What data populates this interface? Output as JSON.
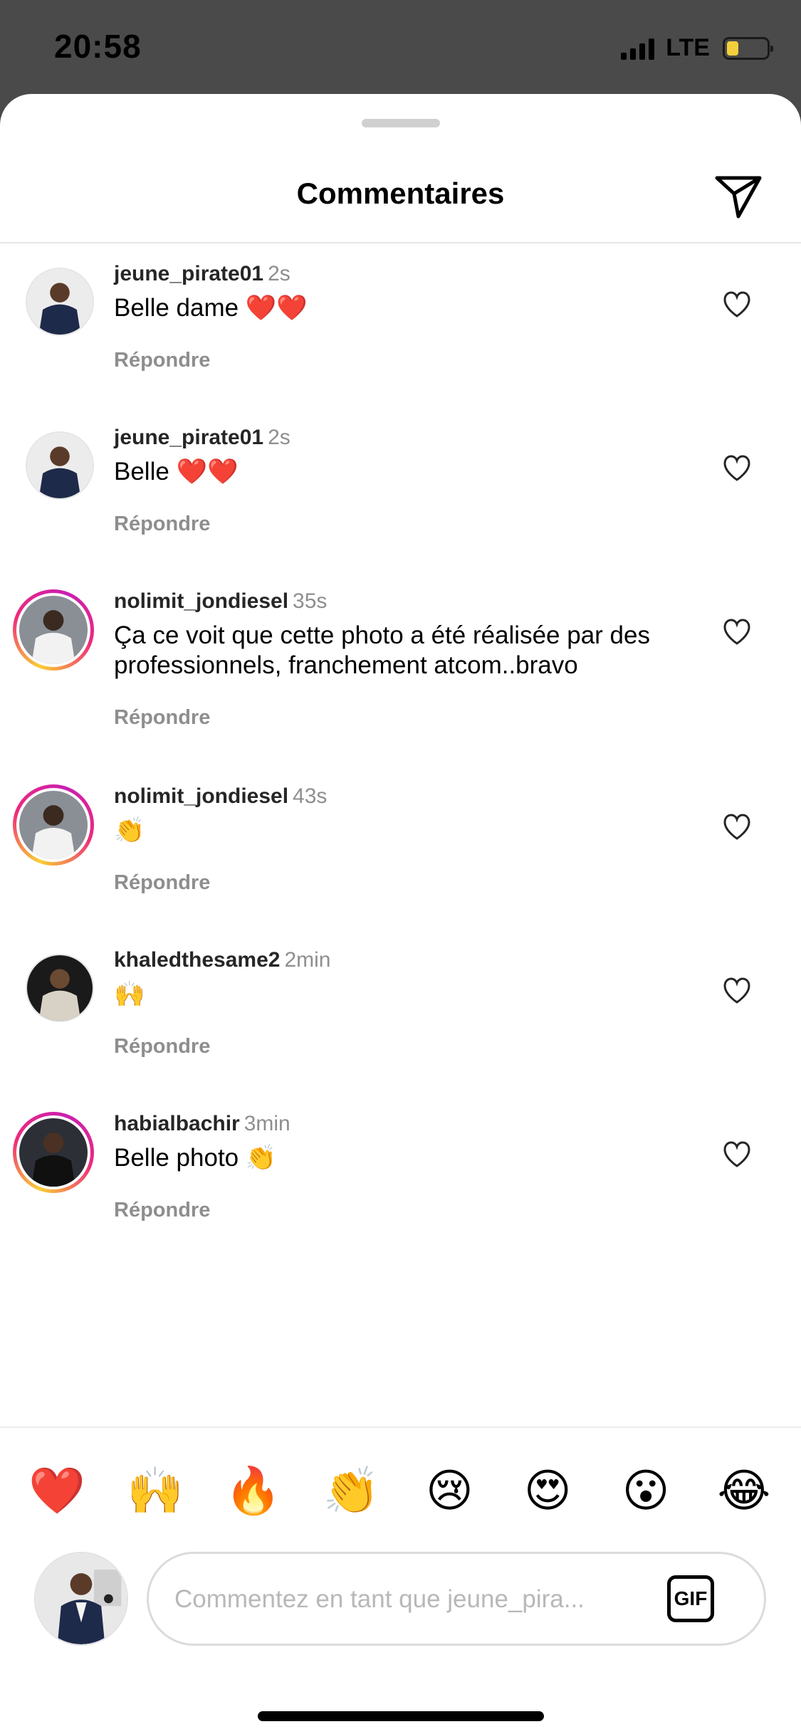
{
  "status_bar": {
    "time": "20:58",
    "network": "LTE",
    "battery_level": 0.3,
    "battery_color": "#f4cf3c"
  },
  "header": {
    "title": "Commentaires",
    "send_icon": "paper-plane-icon"
  },
  "comments": [
    {
      "username": "jeune_pirate01",
      "time": "2s",
      "text": "Belle dame ❤️❤️",
      "reply": "Répondre",
      "story_ring": false
    },
    {
      "username": "jeune_pirate01",
      "time": "2s",
      "text": "Belle ❤️❤️",
      "reply": "Répondre",
      "story_ring": false
    },
    {
      "username": "nolimit_jondiesel",
      "time": "35s",
      "text": "Ça ce voit que cette photo a été réalisée par des professionnels, franchement atcom..bravo",
      "reply": "Répondre",
      "story_ring": true
    },
    {
      "username": "nolimit_jondiesel",
      "time": "43s",
      "text": "👏",
      "reply": "Répondre",
      "story_ring": true
    },
    {
      "username": "khaledthesame2",
      "time": "2min",
      "text": "🙌",
      "reply": "Répondre",
      "story_ring": false
    },
    {
      "username": "habialbachir",
      "time": "3min",
      "text": "Belle photo 👏",
      "reply": "Répondre",
      "story_ring": true
    }
  ],
  "quick_reactions": [
    "❤️",
    "🙌",
    "🔥",
    "👏",
    "😢",
    "😍",
    "😮",
    "😂"
  ],
  "composer": {
    "placeholder": "Commentez en tant que jeune_pira...",
    "gif_label": "GIF"
  },
  "colors": {
    "story_ring": [
      "#f9ce34",
      "#ee2a7b",
      "#c91fb1"
    ],
    "muted_text": "#8e8e8e"
  }
}
